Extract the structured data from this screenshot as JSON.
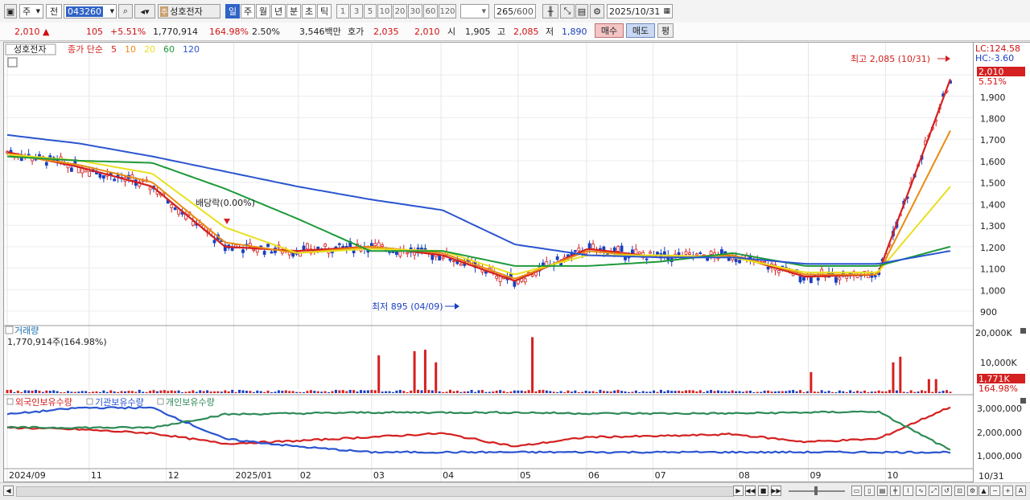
{
  "toolbar": {
    "market_label": "주",
    "period_label": "전",
    "stock_code": "043260",
    "stock_name": "성호전자",
    "intervals": [
      "일",
      "주",
      "월",
      "년",
      "분",
      "초",
      "틱"
    ],
    "selected_interval": "일",
    "minute_steps": [
      "1",
      "3",
      "5",
      "10",
      "20",
      "30",
      "60",
      "120"
    ],
    "count": "265",
    "count_max": "/600",
    "date": "2025/10/31"
  },
  "quote": {
    "price": "2,010",
    "arrow": "▲",
    "change": "105",
    "change_pct": "+5.51%",
    "volume": "1,770,914",
    "volume_ratio": "164.98%",
    "turnover": "2.50%",
    "amount": "3,546백만",
    "ask_label": "호가",
    "ask": "2,035",
    "bid": "2,010",
    "open_label": "시",
    "open": "1,905",
    "high_label": "고",
    "high": "2,085",
    "low_label": "저",
    "low": "1,890",
    "buy_label": "매수",
    "sell_label": "매도",
    "avg_label": "평"
  },
  "price_panel": {
    "name": "성호전자",
    "ma_label": "종가 단순",
    "ma_periods": [
      "5",
      "10",
      "20",
      "60",
      "120"
    ],
    "high_note": "최고 2,085 (10/31)",
    "low_note": "최저 895 (04/09)",
    "dividend_note": "배당락(0.00%)",
    "lc_label": "LC:124.58",
    "hc_label": "HC:-3.60",
    "last_price_box": "2,010",
    "last_pct": "5.51%",
    "y_ticks": [
      "1,900",
      "1,800",
      "1,700",
      "1,600",
      "1,500",
      "1,400",
      "1,300",
      "1,200",
      "1,100",
      "1,000",
      "900"
    ]
  },
  "volume_panel": {
    "title": "거래량",
    "value": "1,770,914주(164.98%)",
    "y_ticks": [
      "20,000K",
      "10,000K"
    ],
    "last_box": "1,771K",
    "last_pct": "164.98%"
  },
  "holdings_panel": {
    "series": [
      "외국인보유수량",
      "기관보유수량",
      "개인보유수량"
    ],
    "y_ticks": [
      "3,000,000",
      "2,000,000",
      "1,000,000"
    ]
  },
  "x_axis": [
    "2024/09",
    "11",
    "12",
    "2025/01",
    "02",
    "03",
    "04",
    "05",
    "06",
    "07",
    "08",
    "09",
    "10",
    "10/31"
  ],
  "colors": {
    "ma5": "#d42020",
    "ma10": "#e98b10",
    "ma20": "#e8e020",
    "ma60": "#1e9a3a",
    "ma120": "#2a55d0",
    "up": "#d42020",
    "down": "#1a3fc0",
    "foreign": "#d42020",
    "institution": "#2a55d0",
    "individual": "#2e8b57"
  },
  "chart_data": {
    "type": "line",
    "title": "성호전자",
    "x": [
      "2024/09",
      "11",
      "12",
      "2025/01",
      "02",
      "03",
      "04",
      "05",
      "06",
      "07",
      "08",
      "09",
      "10",
      "10/31"
    ],
    "series": [
      {
        "name": "5",
        "values": [
          1640,
          1570,
          1480,
          1200,
          1180,
          1200,
          1160,
          1040,
          1190,
          1150,
          1160,
          1060,
          1070,
          1980
        ]
      },
      {
        "name": "10",
        "values": [
          1630,
          1580,
          1500,
          1220,
          1170,
          1200,
          1170,
          1050,
          1180,
          1150,
          1160,
          1070,
          1070,
          1740
        ]
      },
      {
        "name": "20",
        "values": [
          1630,
          1600,
          1540,
          1290,
          1170,
          1190,
          1180,
          1070,
          1160,
          1160,
          1150,
          1080,
          1080,
          1480
        ]
      },
      {
        "name": "60",
        "values": [
          1620,
          1600,
          1590,
          1470,
          1330,
          1180,
          1180,
          1110,
          1110,
          1130,
          1170,
          1110,
          1110,
          1200
        ]
      },
      {
        "name": "120",
        "values": [
          1720,
          1680,
          1620,
          1550,
          1480,
          1420,
          1370,
          1210,
          1160,
          1150,
          1150,
          1120,
          1120,
          1180
        ]
      }
    ],
    "ylim": [
      840,
      2120
    ],
    "high": 2085,
    "low": 895,
    "last": 2010
  }
}
